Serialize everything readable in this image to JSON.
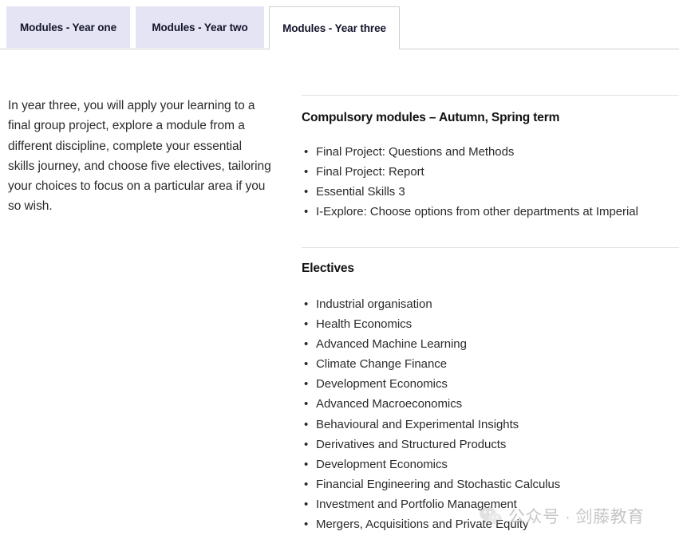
{
  "tabs": [
    {
      "label": "Modules - Year one",
      "active": false
    },
    {
      "label": "Modules - Year two",
      "active": false
    },
    {
      "label": "Modules - Year three",
      "active": true
    }
  ],
  "intro": {
    "paragraph": "In year three, you will apply your learning to a final group project, explore a module from a different discipline, complete your essential skills journey, and choose five electives, tailoring your choices to focus on a particular area if you so wish."
  },
  "sections": [
    {
      "title": "Compulsory modules – Autumn, Spring term",
      "items": [
        "Final Project: Questions and Methods",
        "Final Project: Report",
        "Essential Skills 3",
        "I-Explore: Choose options from other departments at Imperial"
      ]
    },
    {
      "title": "Electives",
      "items": [
        "Industrial organisation",
        "Health Economics",
        "Advanced Machine Learning",
        "Climate Change Finance",
        "Development Economics",
        "Advanced Macroeconomics",
        "Behavioural and Experimental Insights",
        "Derivatives and Structured Products",
        "Development Economics",
        "Financial Engineering and Stochastic Calculus",
        "Investment and Portfolio Management",
        "Mergers, Acquisitions and Private Equity"
      ]
    }
  ],
  "watermark": {
    "text": "公众号 · 剑藤教育",
    "logo": "wechat-logo"
  },
  "colors": {
    "tab_inactive_bg": "#e4e4f4",
    "tab_active_bg": "#ffffff",
    "tab_border": "#cfcfcf",
    "rule": "#e2e2e2",
    "text": "#2b2b2b",
    "heading": "#111111",
    "watermark": "#bdbdbd"
  }
}
